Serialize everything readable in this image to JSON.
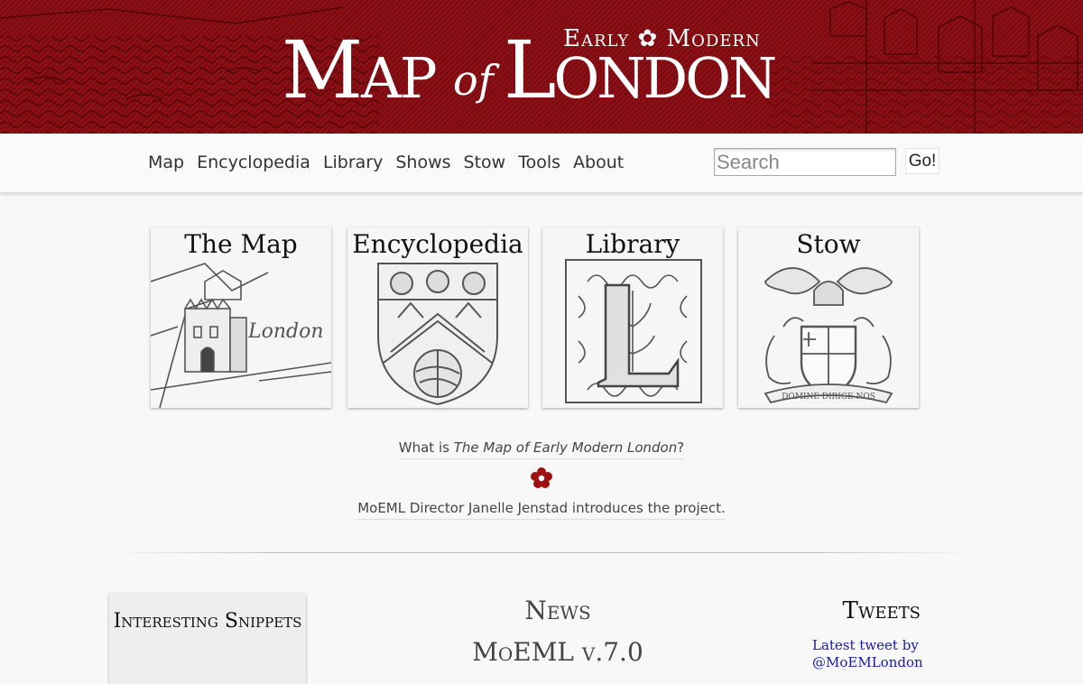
{
  "header": {
    "logo_small": "Early ✿ Modern",
    "logo_map": "Map",
    "logo_of": "of",
    "logo_london": "London"
  },
  "nav": [
    "Map",
    "Encyclopedia",
    "Library",
    "Shows",
    "Stow",
    "Tools",
    "About"
  ],
  "search": {
    "placeholder": "Search",
    "button_label": "Go!"
  },
  "tiles": [
    {
      "title": "The Map",
      "image": "map-detail-london"
    },
    {
      "title": "Encyclopedia",
      "image": "coat-of-arms-shield"
    },
    {
      "title": "Library",
      "image": "ornamental-letter-l"
    },
    {
      "title": "Stow",
      "image": "city-of-london-arms"
    }
  ],
  "intro": {
    "question_prefix": "What is ",
    "question_title": "The Map of Early Modern London",
    "question_suffix": "?",
    "video_text": "MoEML Director Janelle Jenstad introduces the project."
  },
  "snippets": {
    "heading": "Interesting Snippets"
  },
  "news": {
    "heading": "News",
    "item": "MoEML v.7.0"
  },
  "tweets": {
    "heading": "Tweets",
    "link": "Latest tweet by @MoEMLondon"
  },
  "colors": {
    "banner_red": "#8b0f14",
    "flower_red": "#a01010",
    "tweet_link": "#1a1aa6"
  }
}
